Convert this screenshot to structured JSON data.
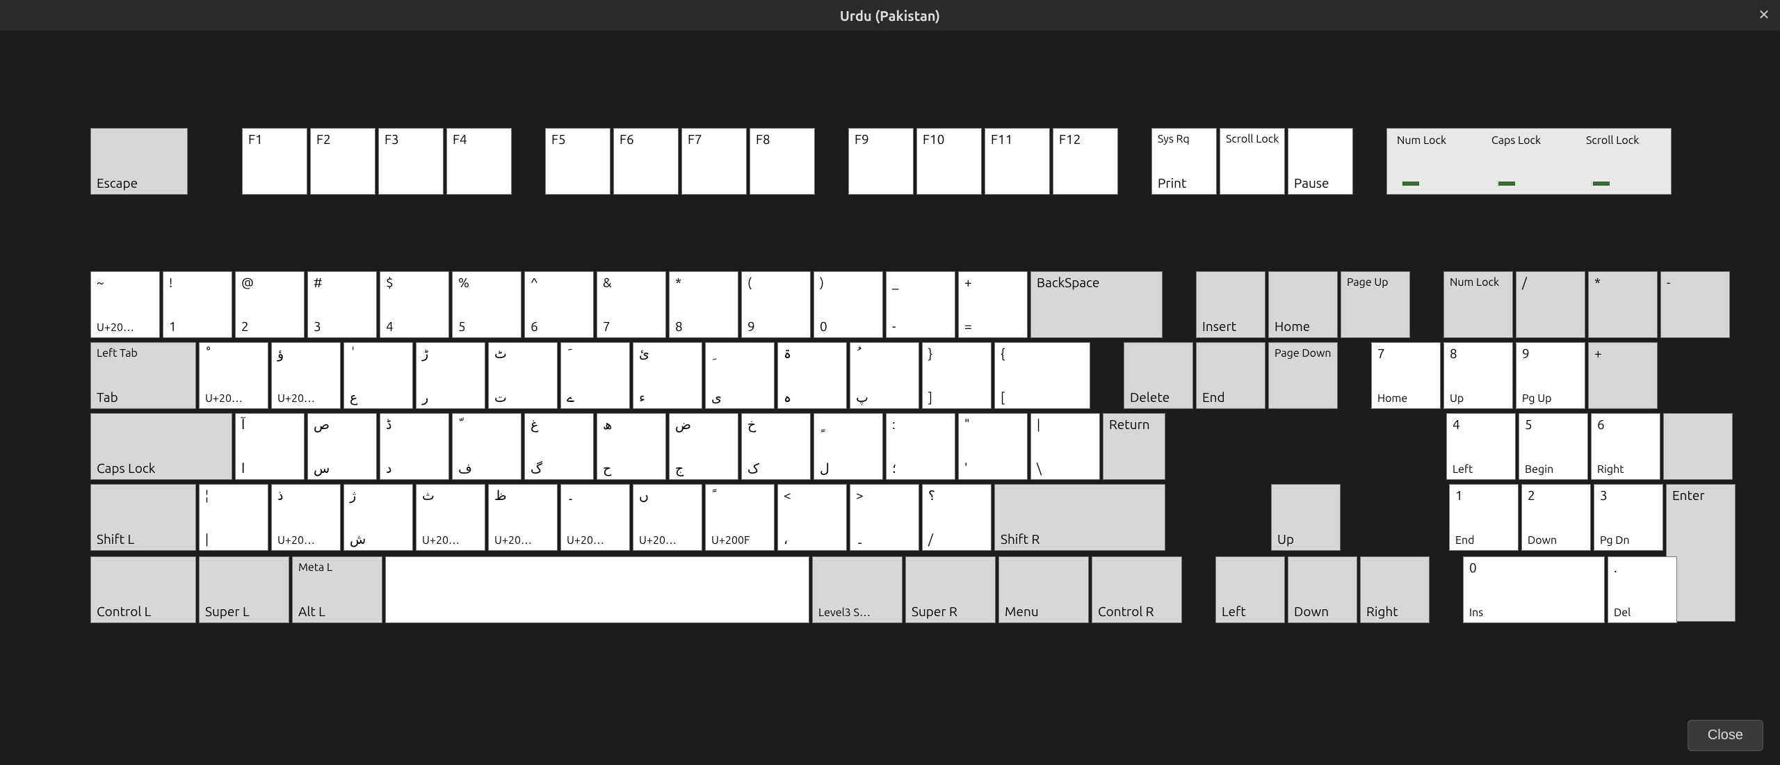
{
  "title": "Urdu (Pakistan)",
  "close_label": "Close",
  "fn_row": {
    "escape": "Escape",
    "f": [
      "F1",
      "F2",
      "F3",
      "F4",
      "F5",
      "F6",
      "F7",
      "F8",
      "F9",
      "F10",
      "F11",
      "F12"
    ],
    "sysrq_top": "Sys Rq",
    "sysrq_bot": "Print",
    "scroll_lock": "Scroll Lock",
    "pause": "Pause",
    "numlock": "Num Lock",
    "capslock": "Caps Lock",
    "scrolllock2": "Scroll Lock"
  },
  "row1": {
    "tilde": {
      "tl": "~",
      "bl": "U+20…"
    },
    "n1": {
      "tl": "!",
      "bl": "1"
    },
    "n2": {
      "tl": "@",
      "bl": "2"
    },
    "n3": {
      "tl": "#",
      "bl": "3"
    },
    "n4": {
      "tl": "$",
      "bl": "4"
    },
    "n5": {
      "tl": "%",
      "bl": "5"
    },
    "n6": {
      "tl": "^",
      "bl": "6"
    },
    "n7": {
      "tl": "&",
      "bl": "7"
    },
    "n8": {
      "tl": "*",
      "bl": "8"
    },
    "n9": {
      "tl": "(",
      "bl": "9"
    },
    "n0": {
      "tl": ")",
      "bl": "0"
    },
    "minus": {
      "tl": "_",
      "bl": "-"
    },
    "equal": {
      "tl": "+",
      "bl": "="
    },
    "backspace": "BackSpace"
  },
  "row2": {
    "tab_top": "Left Tab",
    "tab_bot": "Tab",
    "q": {
      "tl": "ْ",
      "bl": "U+20…"
    },
    "w": {
      "tl": "ؤ",
      "bl": "U+20…"
    },
    "e": {
      "tl": "ٰ",
      "bl": "ع"
    },
    "r": {
      "tl": "ڑ",
      "bl": "ر"
    },
    "t": {
      "tl": "ٹ",
      "bl": "ت"
    },
    "y": {
      "tl": "َ",
      "bl": "ے"
    },
    "u": {
      "tl": "ئ",
      "bl": "ء"
    },
    "i": {
      "tl": "ِ",
      "bl": "ی"
    },
    "o": {
      "tl": "ۃ",
      "bl": "ہ"
    },
    "p": {
      "tl": "ُ",
      "bl": "پ"
    },
    "lb": {
      "tl": "}",
      "bl": "]"
    },
    "rb": {
      "tl": "{",
      "bl": "["
    }
  },
  "row3": {
    "caps": "Caps Lock",
    "a": {
      "tl": "آ",
      "bl": "ا"
    },
    "s": {
      "tl": "ص",
      "bl": "س"
    },
    "d": {
      "tl": "ڈ",
      "bl": "د"
    },
    "f": {
      "tl": "ّ",
      "bl": "ف"
    },
    "g": {
      "tl": "غ",
      "bl": "گ"
    },
    "h": {
      "tl": "ھ",
      "bl": "ح"
    },
    "j": {
      "tl": "ض",
      "bl": "ج"
    },
    "k": {
      "tl": "خ",
      "bl": "ک"
    },
    "l": {
      "tl": "ٍ",
      "bl": "ل"
    },
    "semi": {
      "tl": ":",
      "bl": "؛"
    },
    "quote": {
      "tl": "\"",
      "bl": "'"
    },
    "bslash": {
      "tl": "|",
      "bl": "\\"
    },
    "return": "Return"
  },
  "row4": {
    "shiftl": "Shift L",
    "lsgt": {
      "tl": "¦",
      "bl": "|"
    },
    "z": {
      "tl": "ذ",
      "bl": "U+20…"
    },
    "x": {
      "tl": "ژ",
      "bl": "ش"
    },
    "c": {
      "tl": "ث",
      "bl": "U+20…"
    },
    "v": {
      "tl": "ظ",
      "bl": "U+20…"
    },
    "b": {
      "tl": "۔",
      "bl": "U+20…"
    },
    "n": {
      "tl": "ں",
      "bl": "U+20…"
    },
    "m": {
      "tl": "ً",
      "bl": "U+200F"
    },
    "comma": {
      "tl": "<",
      "bl": "،"
    },
    "period": {
      "tl": ">",
      "bl": "۔"
    },
    "slash": {
      "tl": "؟",
      "bl": "/"
    },
    "shiftr": "Shift R"
  },
  "row5": {
    "ctrl_l": "Control L",
    "super_l": "Super L",
    "meta_top": "Meta L",
    "meta_bot": "Alt L",
    "level3": "Level3 S…",
    "super_r": "Super R",
    "menu": "Menu",
    "ctrl_r": "Control R"
  },
  "nav": {
    "insert": "Insert",
    "home": "Home",
    "pgup": "Page Up",
    "delete": "Delete",
    "end": "End",
    "pgdn": "Page Down",
    "up": "Up",
    "left": "Left",
    "down": "Down",
    "right": "Right"
  },
  "numpad": {
    "numlock": "Num Lock",
    "div": "/",
    "mul": "*",
    "sub": "-",
    "k7t": "7",
    "k7b": "Home",
    "k8t": "8",
    "k8b": "Up",
    "k9t": "9",
    "k9b": "Pg Up",
    "add": "+",
    "k4t": "4",
    "k4b": "Left",
    "k5t": "5",
    "k5b": "Begin",
    "k6t": "6",
    "k6b": "Right",
    "k1t": "1",
    "k1b": "End",
    "k2t": "2",
    "k2b": "Down",
    "k3t": "3",
    "k3b": "Pg Dn",
    "k0t": "0",
    "k0b": "Ins",
    "kdt": ".",
    "kdb": "Del",
    "enter": "Enter"
  }
}
